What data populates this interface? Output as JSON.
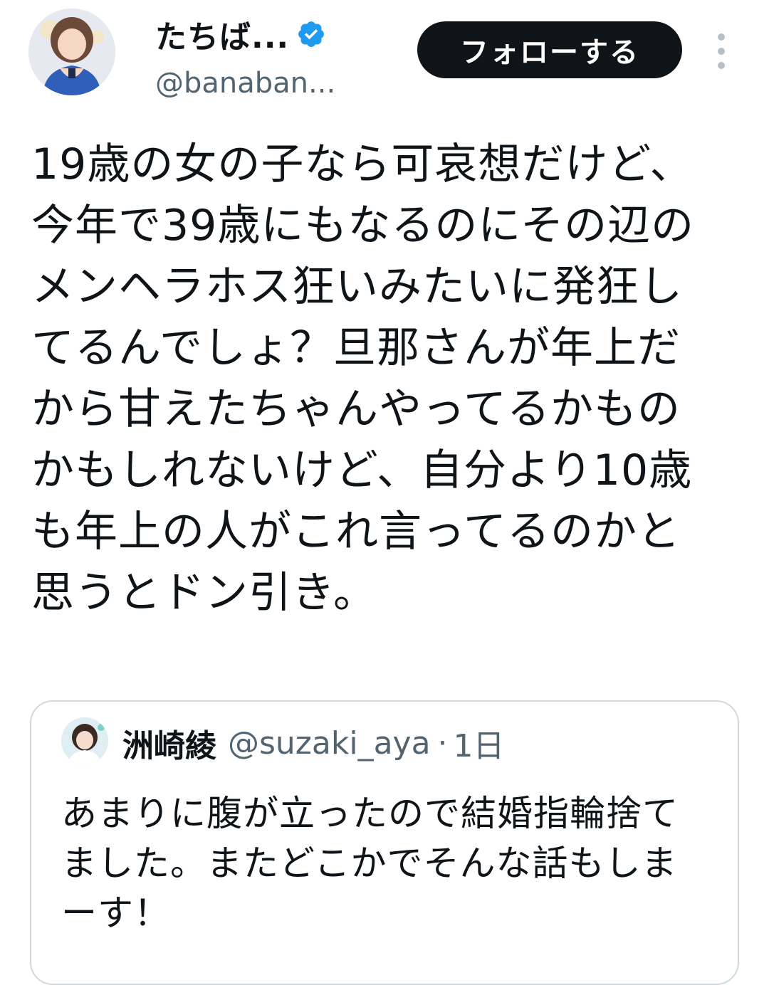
{
  "author": {
    "display_name": "たちば...",
    "handle": "@banaban...",
    "verified": true,
    "avatar_icon": "profile-photo"
  },
  "follow_button": {
    "label": "フォローする"
  },
  "more_menu_icon": "vertical-dots-icon",
  "tweet": {
    "text": "19歳の女の子なら可哀想だけど、今年で39歳にもなるのにその辺のメンヘラホス狂いみたいに発狂してるんでしょ？旦那さんが年上だから甘えたちゃんやってるかものかもしれないけど、自分より10歳も年上の人がこれ言ってるのかと思うとドン引き。"
  },
  "quoted_tweet": {
    "name": "洲崎綾",
    "handle": "@suzaki_aya",
    "separator": "·",
    "time": "1日",
    "text": "あまりに腹が立ったので結婚指輪捨てました。またどこかでそんな話もしまーす！"
  },
  "colors": {
    "text_primary": "#0f1419",
    "text_secondary": "#536471",
    "verified_blue": "#1d9bf0",
    "button_bg": "#0f1419",
    "border": "#cfd9de"
  }
}
